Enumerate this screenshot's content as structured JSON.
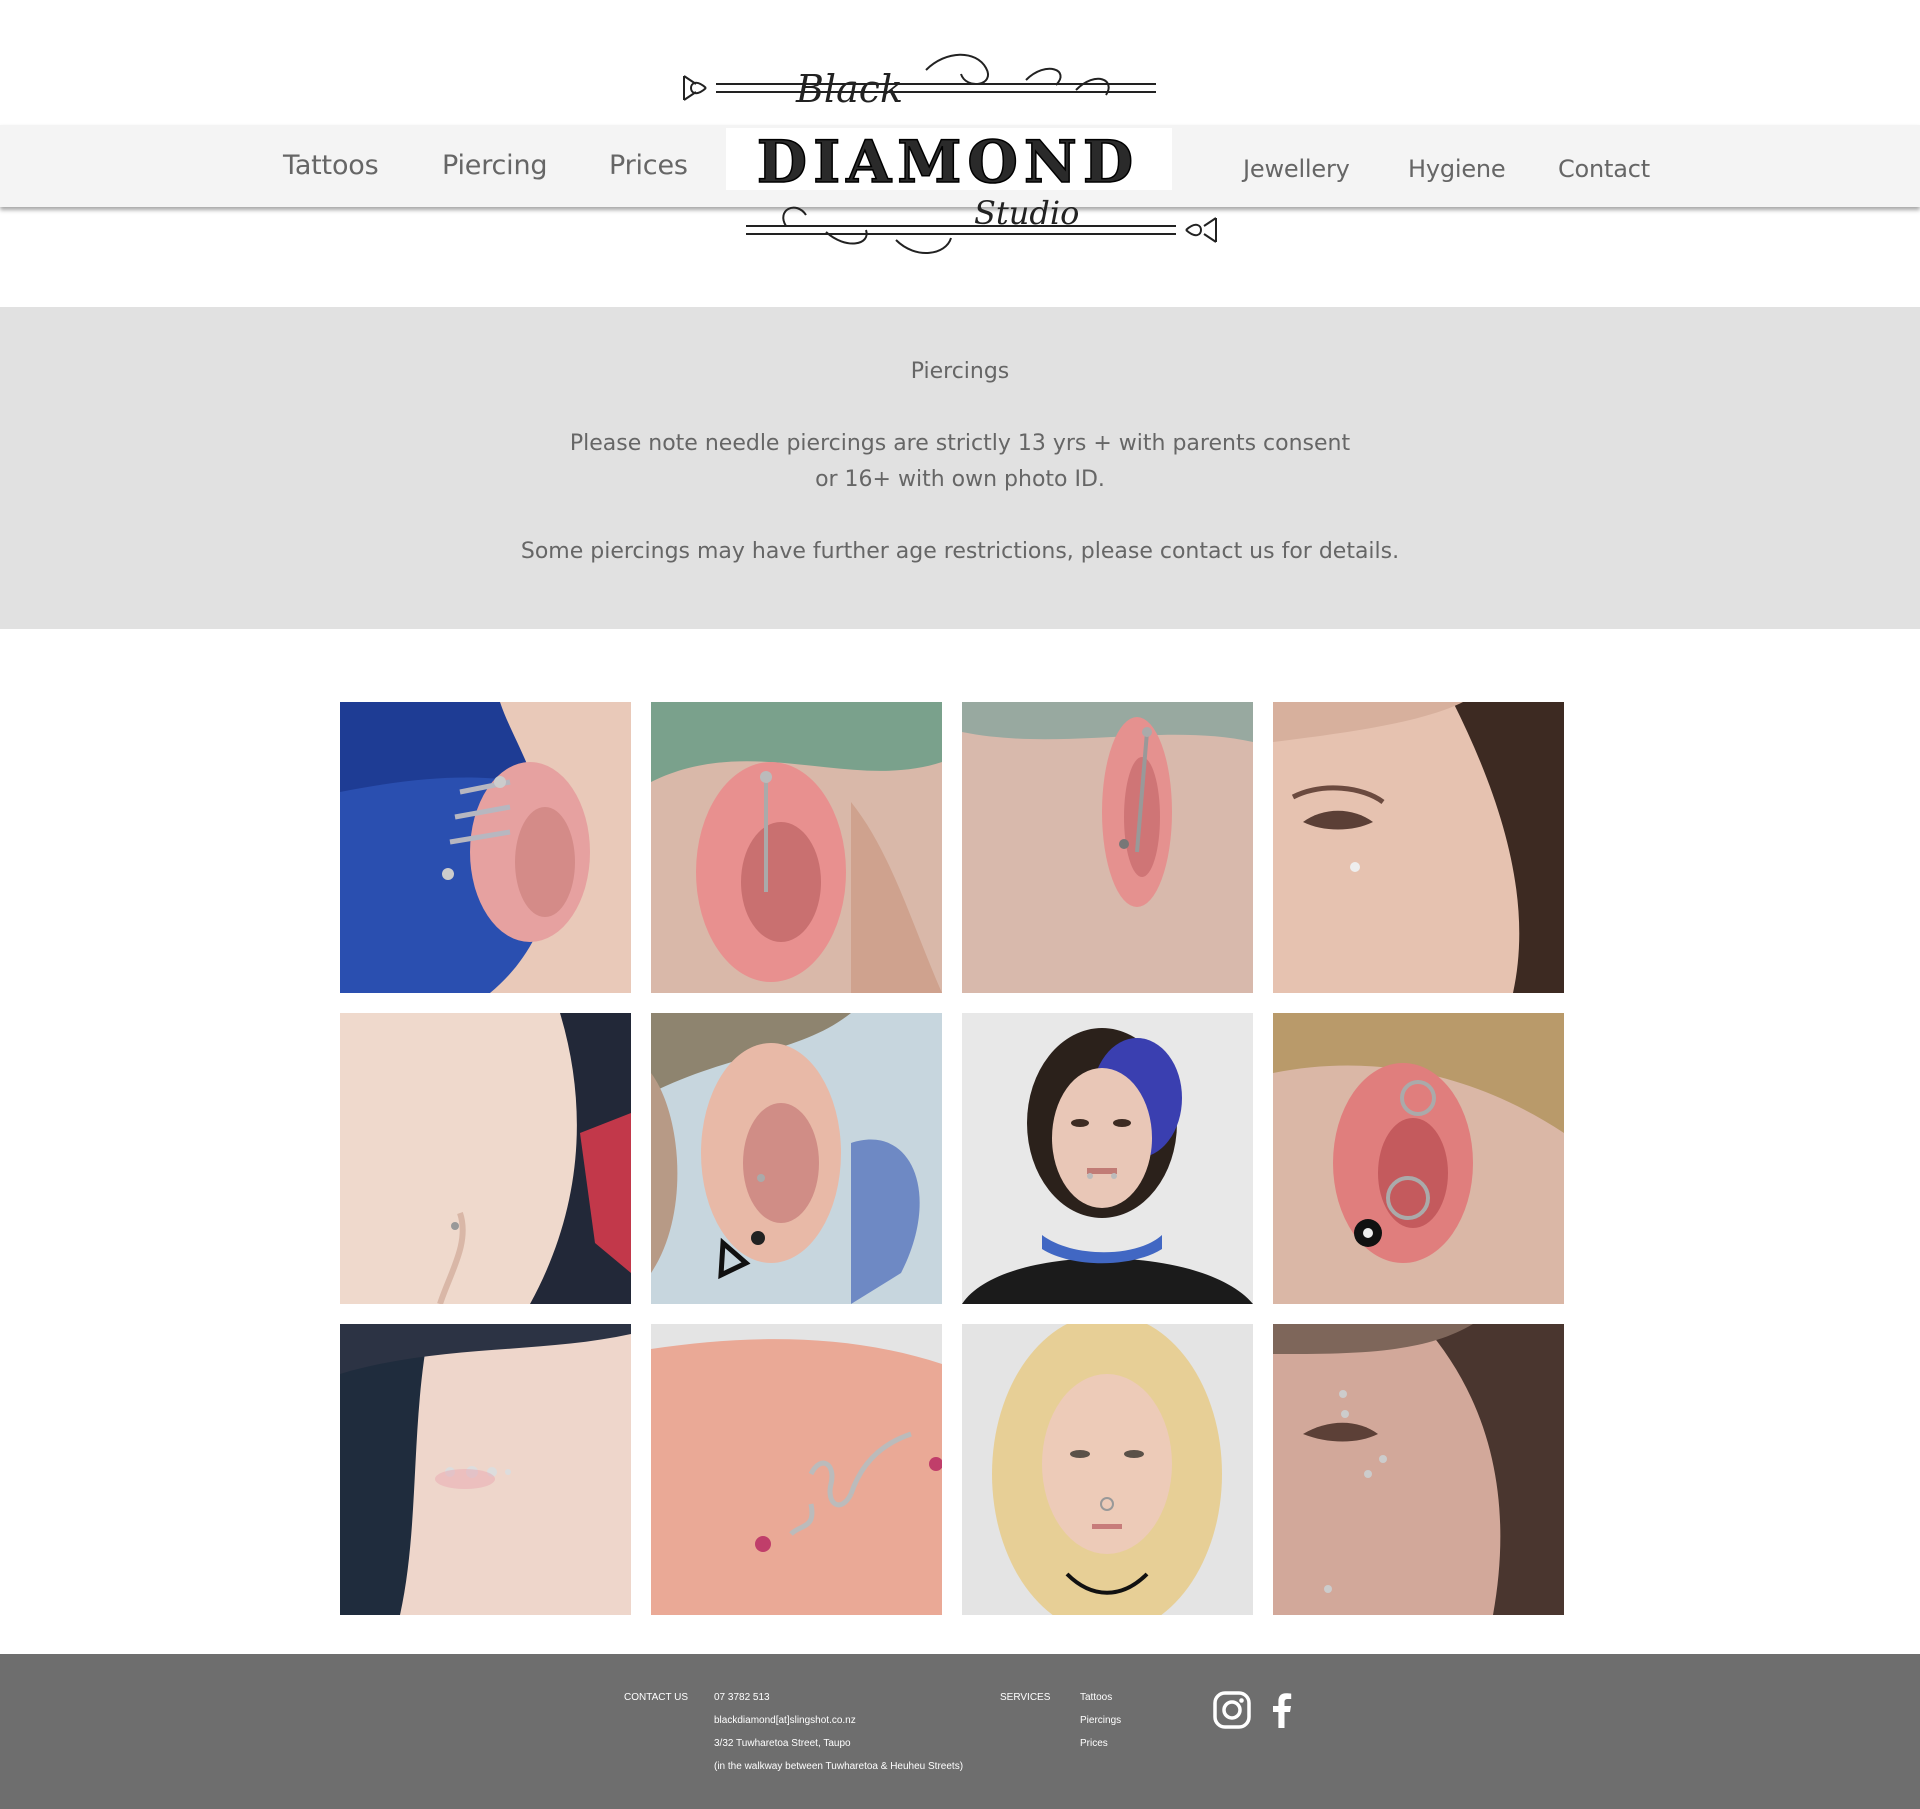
{
  "nav": {
    "left": [
      "Tattoos",
      "Piercing",
      "Prices"
    ],
    "right": [
      "Jewellery",
      "Hygiene",
      "Contact"
    ]
  },
  "logo": {
    "top_word": "Black",
    "main_word": "DIAMOND",
    "bottom_word": "Studio"
  },
  "intro": {
    "title": "Piercings",
    "line1": "Please note needle piercings are strictly 13 yrs + with parents consent",
    "line2": "or 16+ with own photo ID.",
    "line3": "Some piercings may have further age restrictions, please contact us for details."
  },
  "gallery": {
    "tiles": [
      "industrial-spiral-ear-blue-hair",
      "industrial-bar-ear",
      "industrial-bar-ear-side",
      "cheek-dermal",
      "chest-dermal",
      "ear-conch-and-triangle-plug",
      "snake-bite-lip-piercing",
      "ear-rings-and-plug",
      "hip-dermals",
      "arm-surface-wave-bar",
      "septum-blonde",
      "eyebrow-cheek-dermal"
    ]
  },
  "footer": {
    "contact_label": "CONTACT US",
    "phone": "07 3782 513",
    "email": "blackdiamond[at]slingshot.co.nz",
    "address": "3/32 Tuwharetoa Street, Taupo",
    "address_note": "(in the walkway between Tuwharetoa & Heuheu Streets)",
    "services_label": "SERVICES",
    "services": [
      "Tattoos",
      "Piercings",
      "Prices"
    ],
    "social": [
      "instagram-icon",
      "facebook-icon"
    ]
  },
  "colors": {
    "nav_bg": "#f4f4f4",
    "intro_bg": "#e1e1e1",
    "footer_bg": "#6e6e6e",
    "text": "#666666"
  }
}
